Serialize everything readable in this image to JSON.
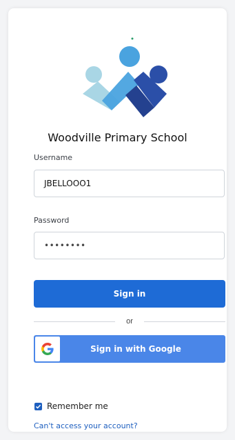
{
  "school": {
    "name": "Woodville Primary School",
    "logo_icon": "woodville-people-logo-icon",
    "colors": {
      "light_blue": "#a9d6e5",
      "mid_blue": "#4aa3df",
      "dark_blue": "#2b4fa8"
    }
  },
  "form": {
    "username_label": "Username",
    "username_value": "JBELLOOO1",
    "password_label": "Password",
    "password_value": "••••••••",
    "signin_label": "Sign in",
    "or_label": "or",
    "google_label": "Sign in with Google",
    "google_icon": "google-g-icon",
    "remember_label": "Remember me",
    "remember_checked": true,
    "cant_access_label": "Can't access your account?"
  },
  "colors": {
    "primary": "#1e6bd6",
    "google": "#4a86e8",
    "link": "#1e5fbf"
  }
}
